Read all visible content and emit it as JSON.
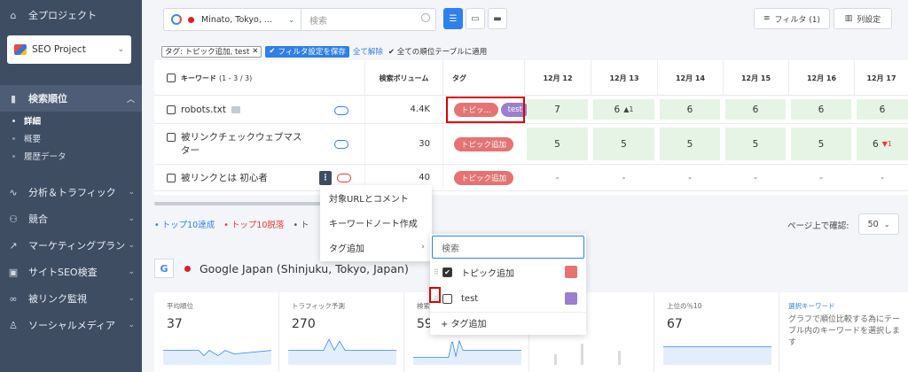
{
  "sidebar": {
    "all_projects": "全プロジェクト",
    "project": "SEO Project",
    "items": [
      {
        "label": "検索順位",
        "icon": "bar-chart-icon"
      },
      {
        "label": "分析＆トラフィック",
        "icon": "pulse-icon"
      },
      {
        "label": "競合",
        "icon": "people-icon"
      },
      {
        "label": "マーケティングプラン",
        "icon": "trend-icon"
      },
      {
        "label": "サイトSEO検査",
        "icon": "audit-icon"
      },
      {
        "label": "被リンク監視",
        "icon": "link-icon"
      },
      {
        "label": "ソーシャルメディア",
        "icon": "thumb-icon"
      }
    ],
    "sub_items": [
      "詳細",
      "概要",
      "履歴データ"
    ]
  },
  "toolbar": {
    "location": "Minato, Tokyo, ...",
    "search_placeholder": "検索",
    "filter_label": "フィルタ (1)",
    "columns_label": "列設定"
  },
  "filter_bar": {
    "chip_label": "タグ: トピック追加, test",
    "chip_close": "✕",
    "save_label": "フィルタ設定を保存",
    "clear_label": "全て解除",
    "apply_label": "全ての順位テーブルに適用"
  },
  "table": {
    "kw_header": "キーワード",
    "kw_count": "(1 - 3 / 3)",
    "volume_header": "検索ボリューム",
    "tag_header": "タグ",
    "dates": [
      "12月 12",
      "12月 13",
      "12月 14",
      "12月 15",
      "12月 16",
      "12月 17"
    ],
    "rows": [
      {
        "keyword": "robots.txt",
        "volume": "4.4K",
        "tags": [
          "トピッ...",
          "test"
        ],
        "ranks": [
          "7",
          "6",
          "6",
          "6",
          "6",
          "6"
        ],
        "change": "▲1"
      },
      {
        "keyword": "被リンクチェックウェブマスター",
        "volume": "30",
        "tags": [
          "トピック追加"
        ],
        "ranks": [
          "5",
          "5",
          "5",
          "5",
          "5",
          "6"
        ],
        "change": "▼1"
      },
      {
        "keyword": "被リンクとは 初心者",
        "volume": "40",
        "tags": [
          "トピック追加"
        ],
        "ranks": [
          "-",
          "-",
          "-",
          "-",
          "-",
          "-"
        ],
        "change": ""
      }
    ]
  },
  "legend": [
    "• トップ10達成",
    "• トップ10脱落",
    "• ト"
  ],
  "pager": {
    "label": "ページ上で確認:",
    "value": "50"
  },
  "context_menu": [
    "対象URLとコメント",
    "キーワードノート作成",
    "タグ追加"
  ],
  "tag_menu": {
    "search_placeholder": "検索",
    "tags": [
      {
        "name": "トピック追加",
        "checked": true,
        "color": "#e57373"
      },
      {
        "name": "test",
        "checked": false,
        "color": "#9a7fd1"
      }
    ],
    "add_label": "+ タグ追加"
  },
  "engine": {
    "title": "Google Japan (Shinjuku, Tokyo, Japan)",
    "badge": "G"
  },
  "stats": [
    {
      "label": "平均順位",
      "value": "37"
    },
    {
      "label": "トラフィック予測",
      "value": "270"
    },
    {
      "label": "検索",
      "value": "59"
    },
    {
      "label": "",
      "value": ""
    },
    {
      "label": "上位の％10",
      "value": "67"
    }
  ],
  "selected_keywords": {
    "title": "選択キーワード",
    "text": "グラフで順位比較する為にテーブル内のキーワードを選択します"
  },
  "colors": {
    "sidebar": "#3f4d63",
    "accent": "#2f7fe6",
    "tag_red": "#e57373",
    "tag_purple": "#9a7fd1",
    "rank_bg": "#e6f4e6",
    "highlight": "#e00000"
  }
}
